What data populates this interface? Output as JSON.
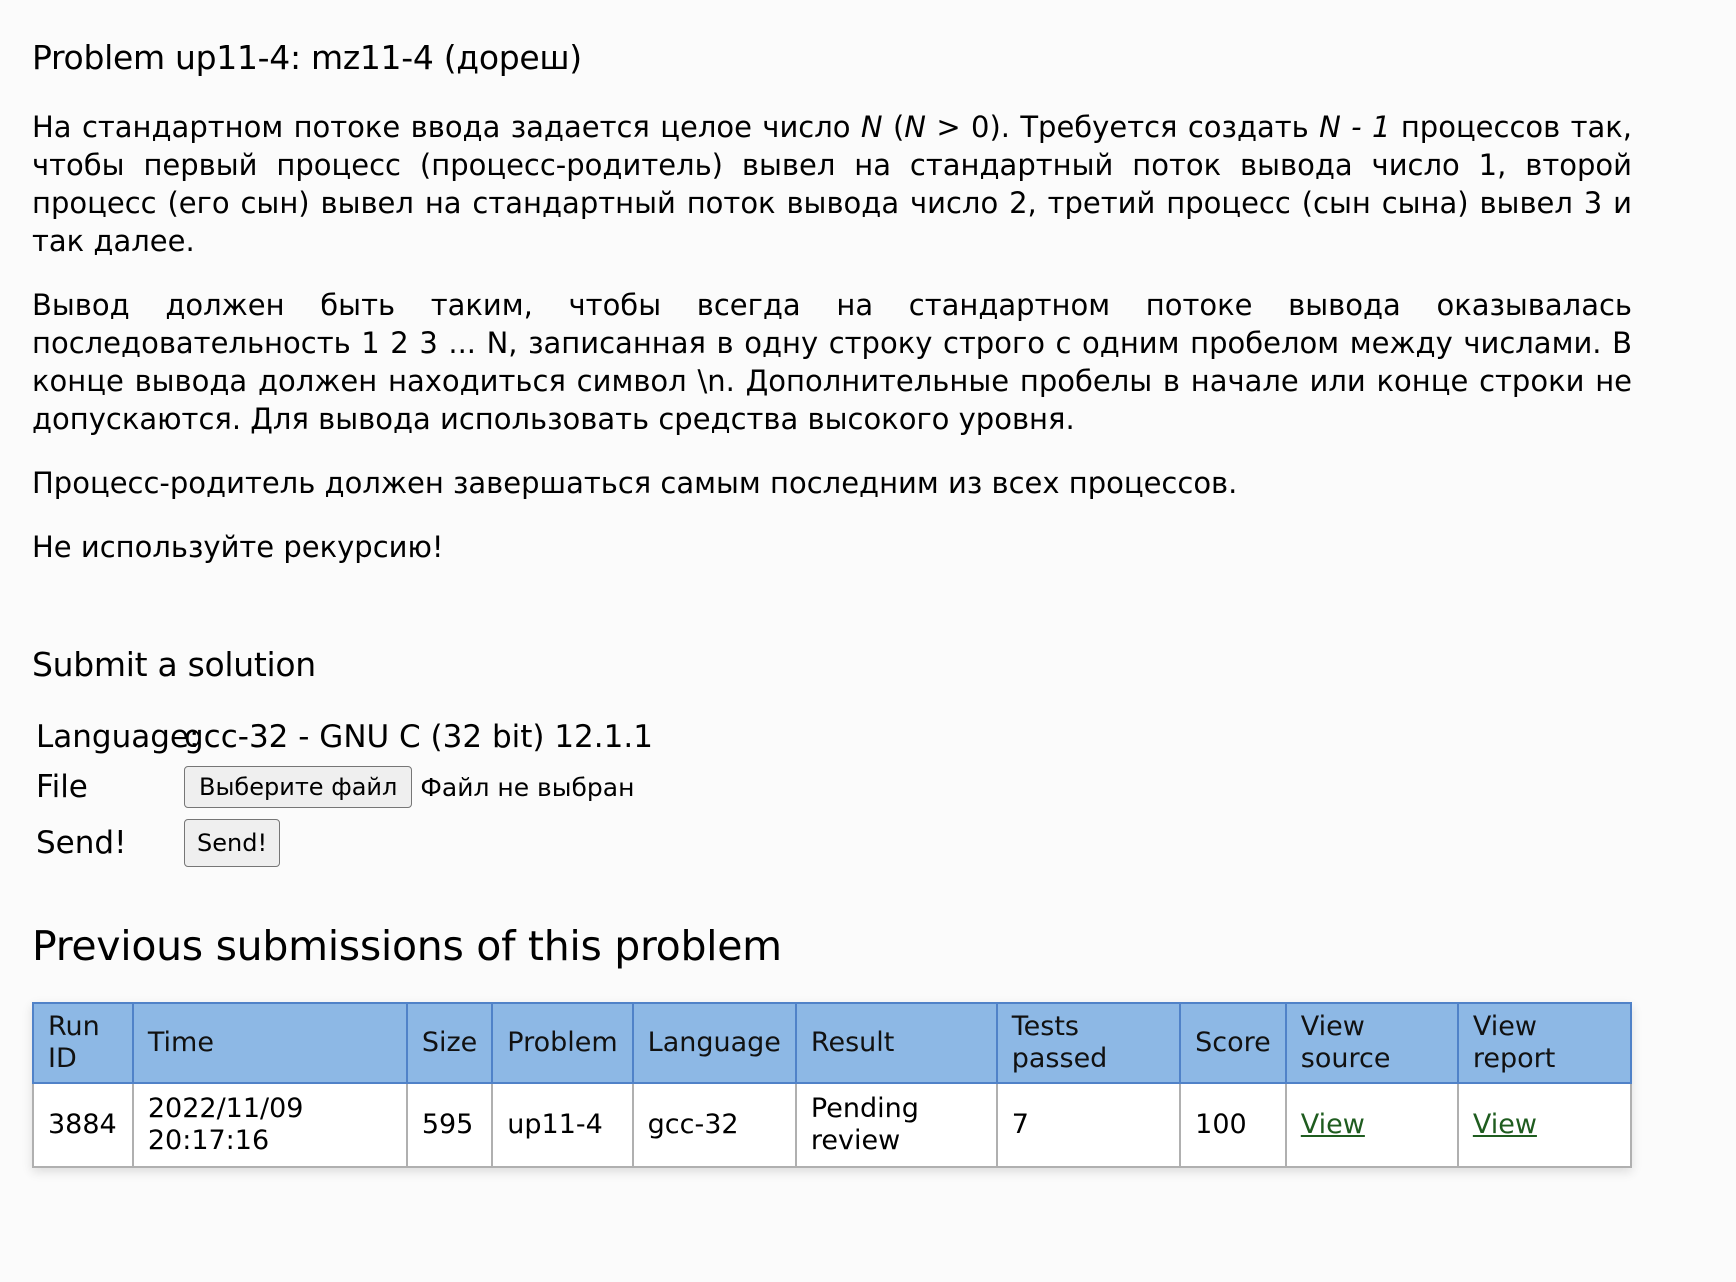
{
  "problem": {
    "title": "Problem up11-4: mz11-4 (дореш)",
    "para1": {
      "t1": "На стандартном потоке ввода задается целое число ",
      "n1": "N",
      "t2": " (",
      "n2": "N",
      "t3": " > 0). Требуется создать ",
      "n3": "N - 1",
      "t4": " процессов так, чтобы первый процесс (процесс-родитель) вывел на стандартный поток вывода число 1, второй процесс (его сын) вывел на стандартный поток вывода число 2, третий процесс (сын сына) вывел 3 и так далее."
    },
    "para2": "Вывод должен быть таким, чтобы всегда на стандартном потоке вывода оказывалась последовательность 1 2 3 ... N, записанная в одну строку строго с одним пробелом между числами. В конце вывода должен находиться символ \\n. Дополнительные пробелы в начале или конце строки не допускаются. Для вывода использовать средства высокого уровня.",
    "para3": "Процесс-родитель должен завершаться самым последним из всех процессов.",
    "para4": "Не используйте рекурсию!"
  },
  "submit": {
    "title": "Submit a solution",
    "language_label": "Language:",
    "language_value": "gcc-32 - GNU C (32 bit) 12.1.1",
    "file_label": "File",
    "file_button": "Выберите файл",
    "file_status": "Файл не выбран",
    "send_label": "Send!",
    "send_button": "Send!"
  },
  "submissions": {
    "title": "Previous submissions of this problem",
    "headers": {
      "run_id": "Run ID",
      "time": "Time",
      "size": "Size",
      "problem": "Problem",
      "language": "Language",
      "result": "Result",
      "tests_passed": "Tests passed",
      "score": "Score",
      "view_source": "View source",
      "view_report": "View report"
    },
    "rows": [
      {
        "run_id": "3884",
        "time": "2022/11/09 20:17:16",
        "size": "595",
        "problem": "up11-4",
        "language": "gcc-32",
        "result": "Pending review",
        "tests_passed": "7",
        "score": "100",
        "view_source": "View",
        "view_report": "View"
      }
    ]
  },
  "colors": {
    "header_bg": "#8db8e5",
    "header_border": "#5082c8",
    "link": "#1f5c1f"
  }
}
